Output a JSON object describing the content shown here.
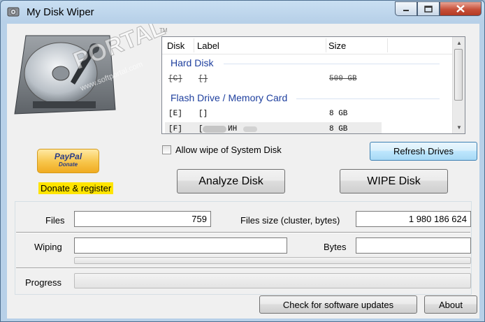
{
  "window": {
    "title": "My Disk Wiper"
  },
  "watermark": {
    "brand": "PORTAL",
    "site": "www.softportal.com",
    "tm": "TM"
  },
  "disk_list": {
    "columns": [
      "Disk",
      "Label",
      "Size"
    ],
    "groups": [
      {
        "title": "Hard Disk",
        "rows": [
          {
            "disk": "[C]",
            "label": "[]",
            "size": "500 GB",
            "disabled": true
          }
        ]
      },
      {
        "title": "Flash Drive / Memory Card",
        "rows": [
          {
            "disk": "[E]",
            "label": "[]",
            "size": "8 GB"
          },
          {
            "disk": "[F]",
            "label": "[",
            "label_tail": "ИН",
            "size": "8 GB",
            "selected": true
          }
        ]
      }
    ]
  },
  "paypal": {
    "brand": "PayPal",
    "sub": "Donate"
  },
  "donate_link": "Donate & register",
  "checkbox": {
    "label": "Allow wipe of System Disk",
    "checked": false
  },
  "buttons": {
    "refresh": "Refresh Drives",
    "analyze": "Analyze Disk",
    "wipe": "WIPE Disk",
    "updates": "Check for software updates",
    "about": "About"
  },
  "fields": {
    "files_label": "Files",
    "files_value": "759",
    "size_label": "Files size (cluster, bytes)",
    "size_value": "1 980 186 624",
    "wiping_label": "Wiping",
    "wiping_value": "",
    "bytes_label": "Bytes",
    "bytes_value": "",
    "progress_label": "Progress"
  },
  "progress": {
    "wiping": 0,
    "overall": 0
  },
  "colors": {
    "group_title": "#1e3f9e",
    "donate_bg": "#ffe400",
    "close_button": "#c7503a"
  }
}
